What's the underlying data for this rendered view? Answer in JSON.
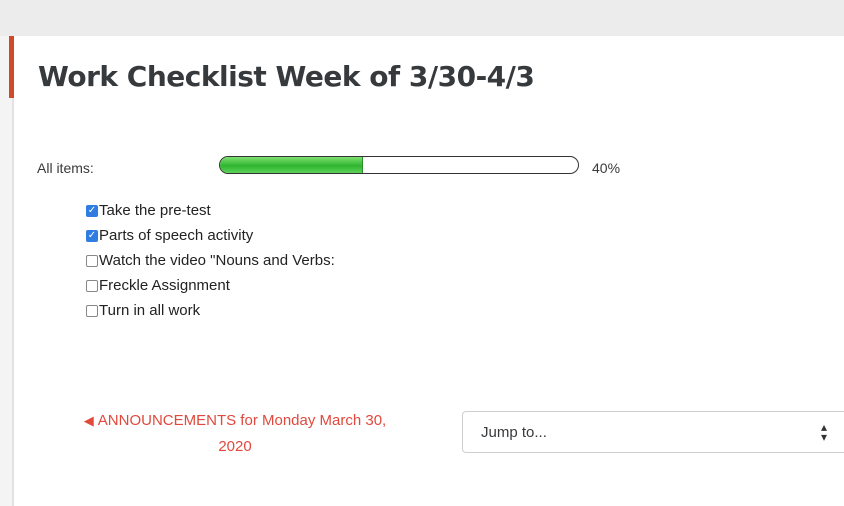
{
  "page": {
    "title": "Work Checklist Week of 3/30-4/3",
    "accent_color": "#d04a2a"
  },
  "progress": {
    "label": "All items:",
    "percent_text": "40%",
    "fraction": 0.4,
    "fill_color": "#2fb52f"
  },
  "checklist": {
    "items": [
      {
        "label": "Take the pre-test",
        "checked": true
      },
      {
        "label": "Parts of speech activity",
        "checked": true
      },
      {
        "label": "Watch the video \"Nouns and Verbs:",
        "checked": false
      },
      {
        "label": "Freckle Assignment",
        "checked": false
      },
      {
        "label": "Turn in all work",
        "checked": false
      }
    ]
  },
  "nav": {
    "prev_arrow_icon": "left-triangle-icon",
    "prev_line1": "ANNOUNCEMENTS for Monday March 30,",
    "prev_line2": "2020",
    "link_color": "#e0493c",
    "jump_placeholder": "Jump to...",
    "jump_caret_icon": "up-down-caret-icon"
  }
}
